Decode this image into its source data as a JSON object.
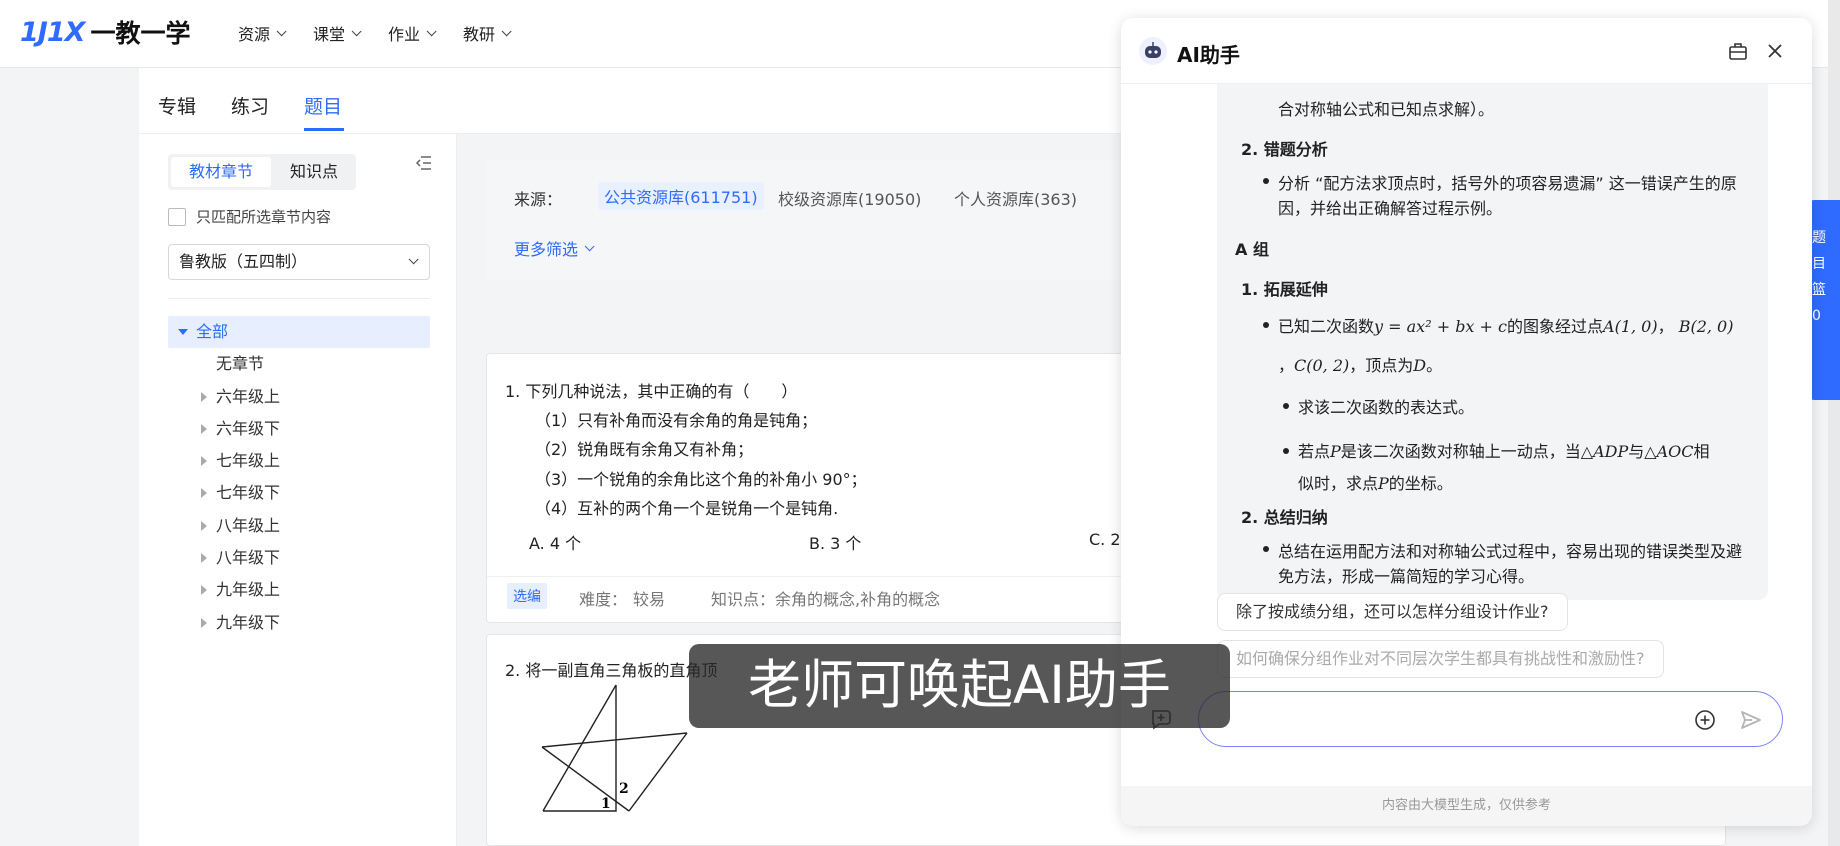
{
  "header": {
    "logo_mark": "1J1X",
    "logo_text": "一教一学",
    "nav": [
      {
        "label": "资源"
      },
      {
        "label": "课堂"
      },
      {
        "label": "作业"
      },
      {
        "label": "教研"
      }
    ]
  },
  "subnav": {
    "tabs": [
      {
        "label": "专辑"
      },
      {
        "label": "练习"
      },
      {
        "label": "题目"
      }
    ],
    "active": "题目"
  },
  "sidebar": {
    "seg_active": "教材章节",
    "seg_other": "知识点",
    "checkbox_label": "只匹配所选章节内容",
    "edition": "鲁教版（五四制）",
    "tree": [
      {
        "label": "全部"
      },
      {
        "label": "无章节"
      },
      {
        "label": "六年级上"
      },
      {
        "label": "六年级下"
      },
      {
        "label": "七年级上"
      },
      {
        "label": "七年级下"
      },
      {
        "label": "八年级上"
      },
      {
        "label": "八年级下"
      },
      {
        "label": "九年级上"
      },
      {
        "label": "九年级下"
      }
    ]
  },
  "filter": {
    "label": "来源：",
    "sources": [
      {
        "label": "公共资源库(611751)"
      },
      {
        "label": "校级资源库(19050)"
      },
      {
        "label": "个人资源库(363)"
      }
    ],
    "more": "更多筛选"
  },
  "questions": [
    {
      "stem": "1.  下列几种说法，其中正确的有（　　）",
      "items": [
        "（1）只有补角而没有余角的角是钝角；",
        "（2）锐角既有余角又有补角；",
        "（3）一个锐角的余角比这个角的补角小  90°；",
        "（4）互补的两个角一个是锐角一个是钝角."
      ],
      "options": [
        "A. 4 个",
        "B. 3 个",
        "C. 2"
      ],
      "tag": "选编",
      "difficulty_label": "难度：",
      "difficulty": "较易",
      "knowledge_label": "知识点：",
      "knowledge": "余角的概念,补角的概念"
    },
    {
      "stem": "2.  将一副直角三角板的直角顶",
      "diagram_labels": [
        "1",
        "2"
      ]
    }
  ],
  "caption": "老师可唤起AI助手",
  "right_tab_text": "题目篮0",
  "ai": {
    "title": "AI助手",
    "lines": {
      "l0": "合对称轴公式和已知点求解）。",
      "h2": "2. 错题分析",
      "b2a": "分析 “配方法求顶点时，括号外的项容易遗漏” 这一错误产生的原",
      "b2b": "因，并给出正确解答过程示例。",
      "groupA": "A 组",
      "h1": "1. 拓展延伸",
      "p1a": "已知二次函数",
      "p1b": "的图象经过点",
      "p1c": "，",
      "p1d": "，顶点为",
      "p1e": "。",
      "s1": "求该二次函数的表达式。",
      "s2a": "若点",
      "s2b": "是该二次函数对称轴上一动点，当",
      "s2c": "与",
      "s2d": "相",
      "s2e": "似时，求点",
      "s2f": "的坐标。",
      "h3": "2. 总结归纳",
      "b3a": "总结在运用配方法和对称轴公式过程中，容易出现的错误类型及避",
      "b3b": "免方法，形成一篇简短的学习心得。"
    },
    "math": {
      "eq": "y = ax² + bx + c",
      "A": "A(1, 0)",
      "B": "B(2, 0)",
      "C": "C(0, 2)",
      "D": "D",
      "P": "P",
      "tri1": "△ADP",
      "tri2": "△AOC"
    },
    "suggestions": [
      "除了按成绩分组，还可以怎样分组设计作业?",
      "如何确保分组作业对不同层次学生都具有挑战性和激励性?"
    ],
    "input_value": "",
    "footer": "内容由大模型生成，仅供参考"
  }
}
